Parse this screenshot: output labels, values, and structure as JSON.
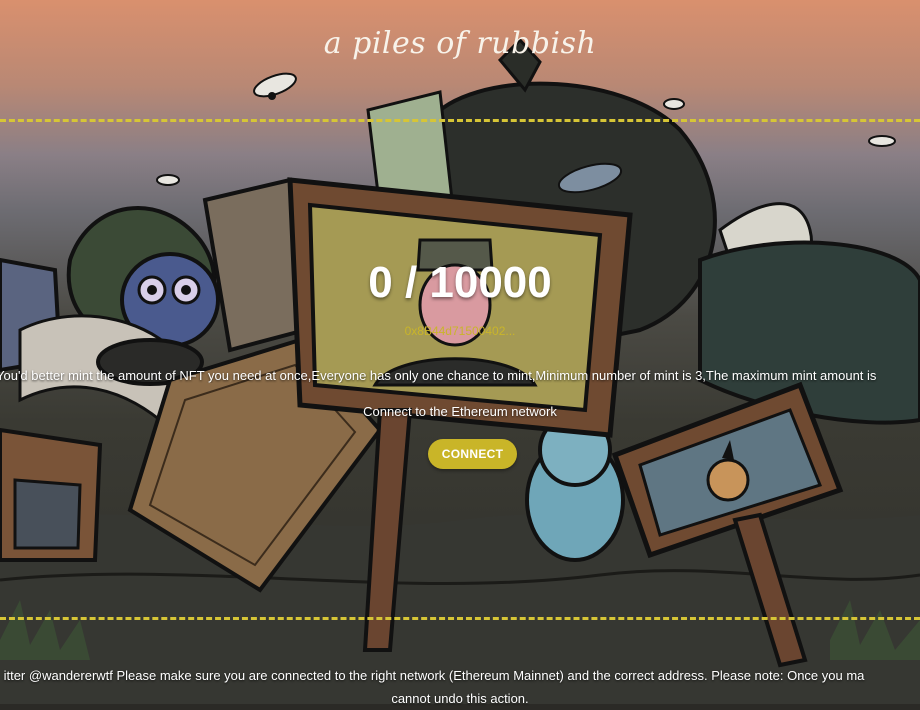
{
  "header": {
    "title": "a piles of rubbish"
  },
  "mint": {
    "counter": "0 / 10000",
    "contract_address": "0x8B44d71500402...",
    "notice": "You'd better mint the amount of NFT you need at once,Everyone has only one chance to mint,Minimum number of mint is 3,The maximum mint amount is",
    "network_prompt": "Connect to the Ethereum network",
    "connect_label": "CONNECT"
  },
  "footer": {
    "line1": "itter @wandererwtf Please make sure you are connected to the right network (Ethereum Mainnet) and the correct address. Please note: Once you ma",
    "line2": "cannot undo this action."
  },
  "colors": {
    "accent": "#c9b528",
    "dashed_line": "#d6c536",
    "sky_top": "#d9906e",
    "text": "#ffffff"
  },
  "icons": [
    "fly-icon",
    "trash-bag",
    "sign-board",
    "ape-portrait",
    "punk-portrait",
    "owl-figure",
    "toy-figure"
  ]
}
